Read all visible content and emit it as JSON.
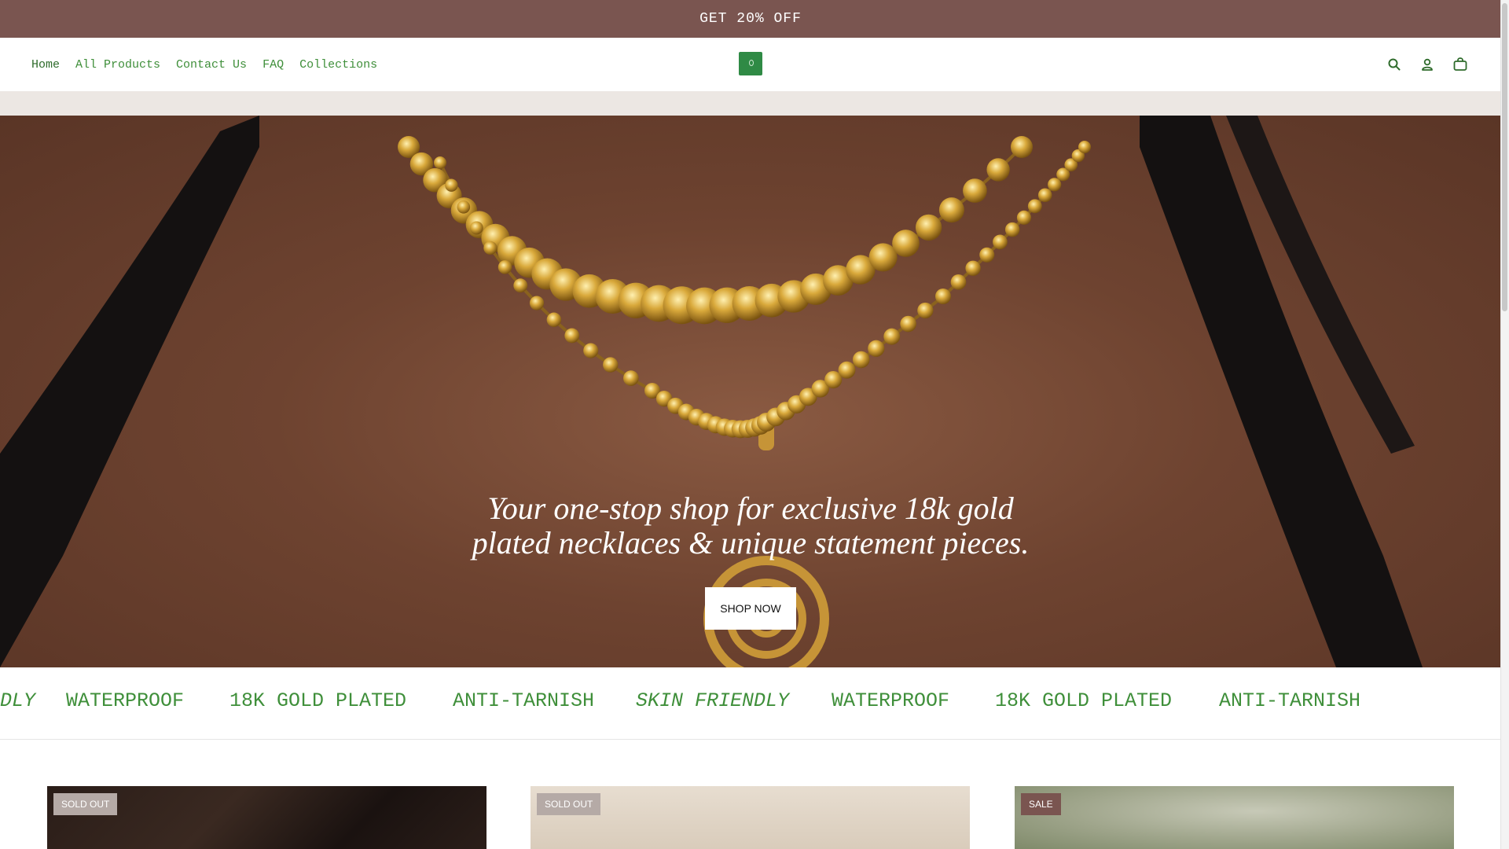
{
  "announcement": {
    "text": "GET 20% OFF"
  },
  "nav": {
    "items": [
      {
        "label": "Home",
        "active": true
      },
      {
        "label": "All Products"
      },
      {
        "label": "Contact Us"
      },
      {
        "label": "FAQ"
      },
      {
        "label": "Collections"
      }
    ]
  },
  "header_icons": [
    "search-icon",
    "account-icon",
    "cart-icon"
  ],
  "hero": {
    "heading_line1": "Your one-stop shop for exclusive 18k gold",
    "heading_line2": "plated necklaces & unique statement pieces.",
    "button_label": "SHOP NOW"
  },
  "marquee": {
    "items": [
      {
        "text": "SKIN FRIENDLY",
        "italic": true
      },
      {
        "text": "WATERPROOF"
      },
      {
        "text": "18K GOLD PLATED"
      },
      {
        "text": "ANTI-TARNISH"
      },
      {
        "text": "SKIN FRIENDLY",
        "italic": true
      },
      {
        "text": "WATERPROOF"
      },
      {
        "text": "18K GOLD PLATED"
      },
      {
        "text": "ANTI-TARNISH"
      }
    ]
  },
  "products": [
    {
      "badge": "SOLD OUT",
      "badge_color": "#b5aaa6"
    },
    {
      "badge": "SOLD OUT",
      "badge_color": "#b5aaa6"
    },
    {
      "badge": "SALE",
      "badge_color": "#7a5550"
    }
  ],
  "colors": {
    "announcement_bg": "#7a5550",
    "nav_link": "#3f8f3a",
    "logo": "#2f8a45",
    "strip": "#ece7e3"
  }
}
